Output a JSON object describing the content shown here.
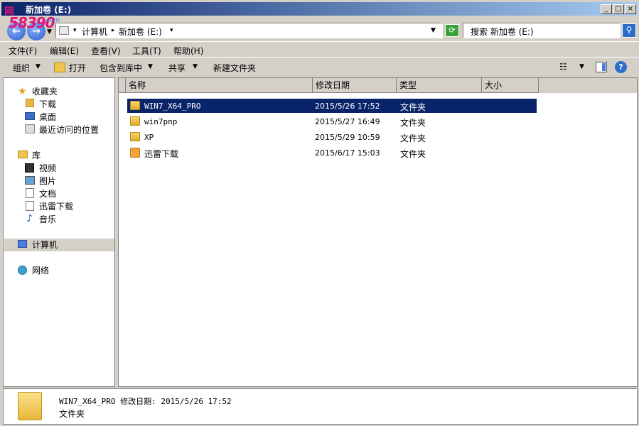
{
  "window": {
    "title": "新加卷 (E:)"
  },
  "logo": {
    "line1": "网",
    "line2": "58390",
    "line3": ".com"
  },
  "address": {
    "crumbs": [
      "计算机",
      "新加卷 (E:)"
    ],
    "search_placeholder": "搜索 新加卷 (E:)"
  },
  "menu": [
    "文件(F)",
    "编辑(E)",
    "查看(V)",
    "工具(T)",
    "帮助(H)"
  ],
  "toolbar": {
    "organize": "组织",
    "open": "打开",
    "include": "包含到库中",
    "share": "共享",
    "new_folder": "新建文件夹"
  },
  "nav": {
    "favorites": "收藏夹",
    "downloads": "下载",
    "desktop": "桌面",
    "recent": "最近访问的位置",
    "libraries": "库",
    "videos": "视频",
    "pictures": "图片",
    "documents": "文档",
    "thunder": "迅雷下载",
    "music": "音乐",
    "computer": "计算机",
    "network": "网络"
  },
  "columns": {
    "name": "名称",
    "date": "修改日期",
    "type": "类型",
    "size": "大小"
  },
  "files": [
    {
      "name": "WIN7_X64_PRO",
      "date": "2015/5/26 17:52",
      "type": "文件夹",
      "icon": "folder-icon"
    },
    {
      "name": "win7pnp",
      "date": "2015/5/27 16:49",
      "type": "文件夹",
      "icon": "folder-icon"
    },
    {
      "name": "XP",
      "date": "2015/5/29 10:59",
      "type": "文件夹",
      "icon": "folder-icon"
    },
    {
      "name": "迅雷下载",
      "date": "2015/6/17 15:03",
      "type": "文件夹",
      "icon": "thunder-folder-icon"
    }
  ],
  "details": {
    "line1": "WIN7_X64_PRO 修改日期: 2015/5/26 17:52",
    "line2": "文件夹"
  },
  "colors": {
    "selection": "#0a246a",
    "titlebar": "#0a246a",
    "chrome": "#d4d0c8"
  }
}
